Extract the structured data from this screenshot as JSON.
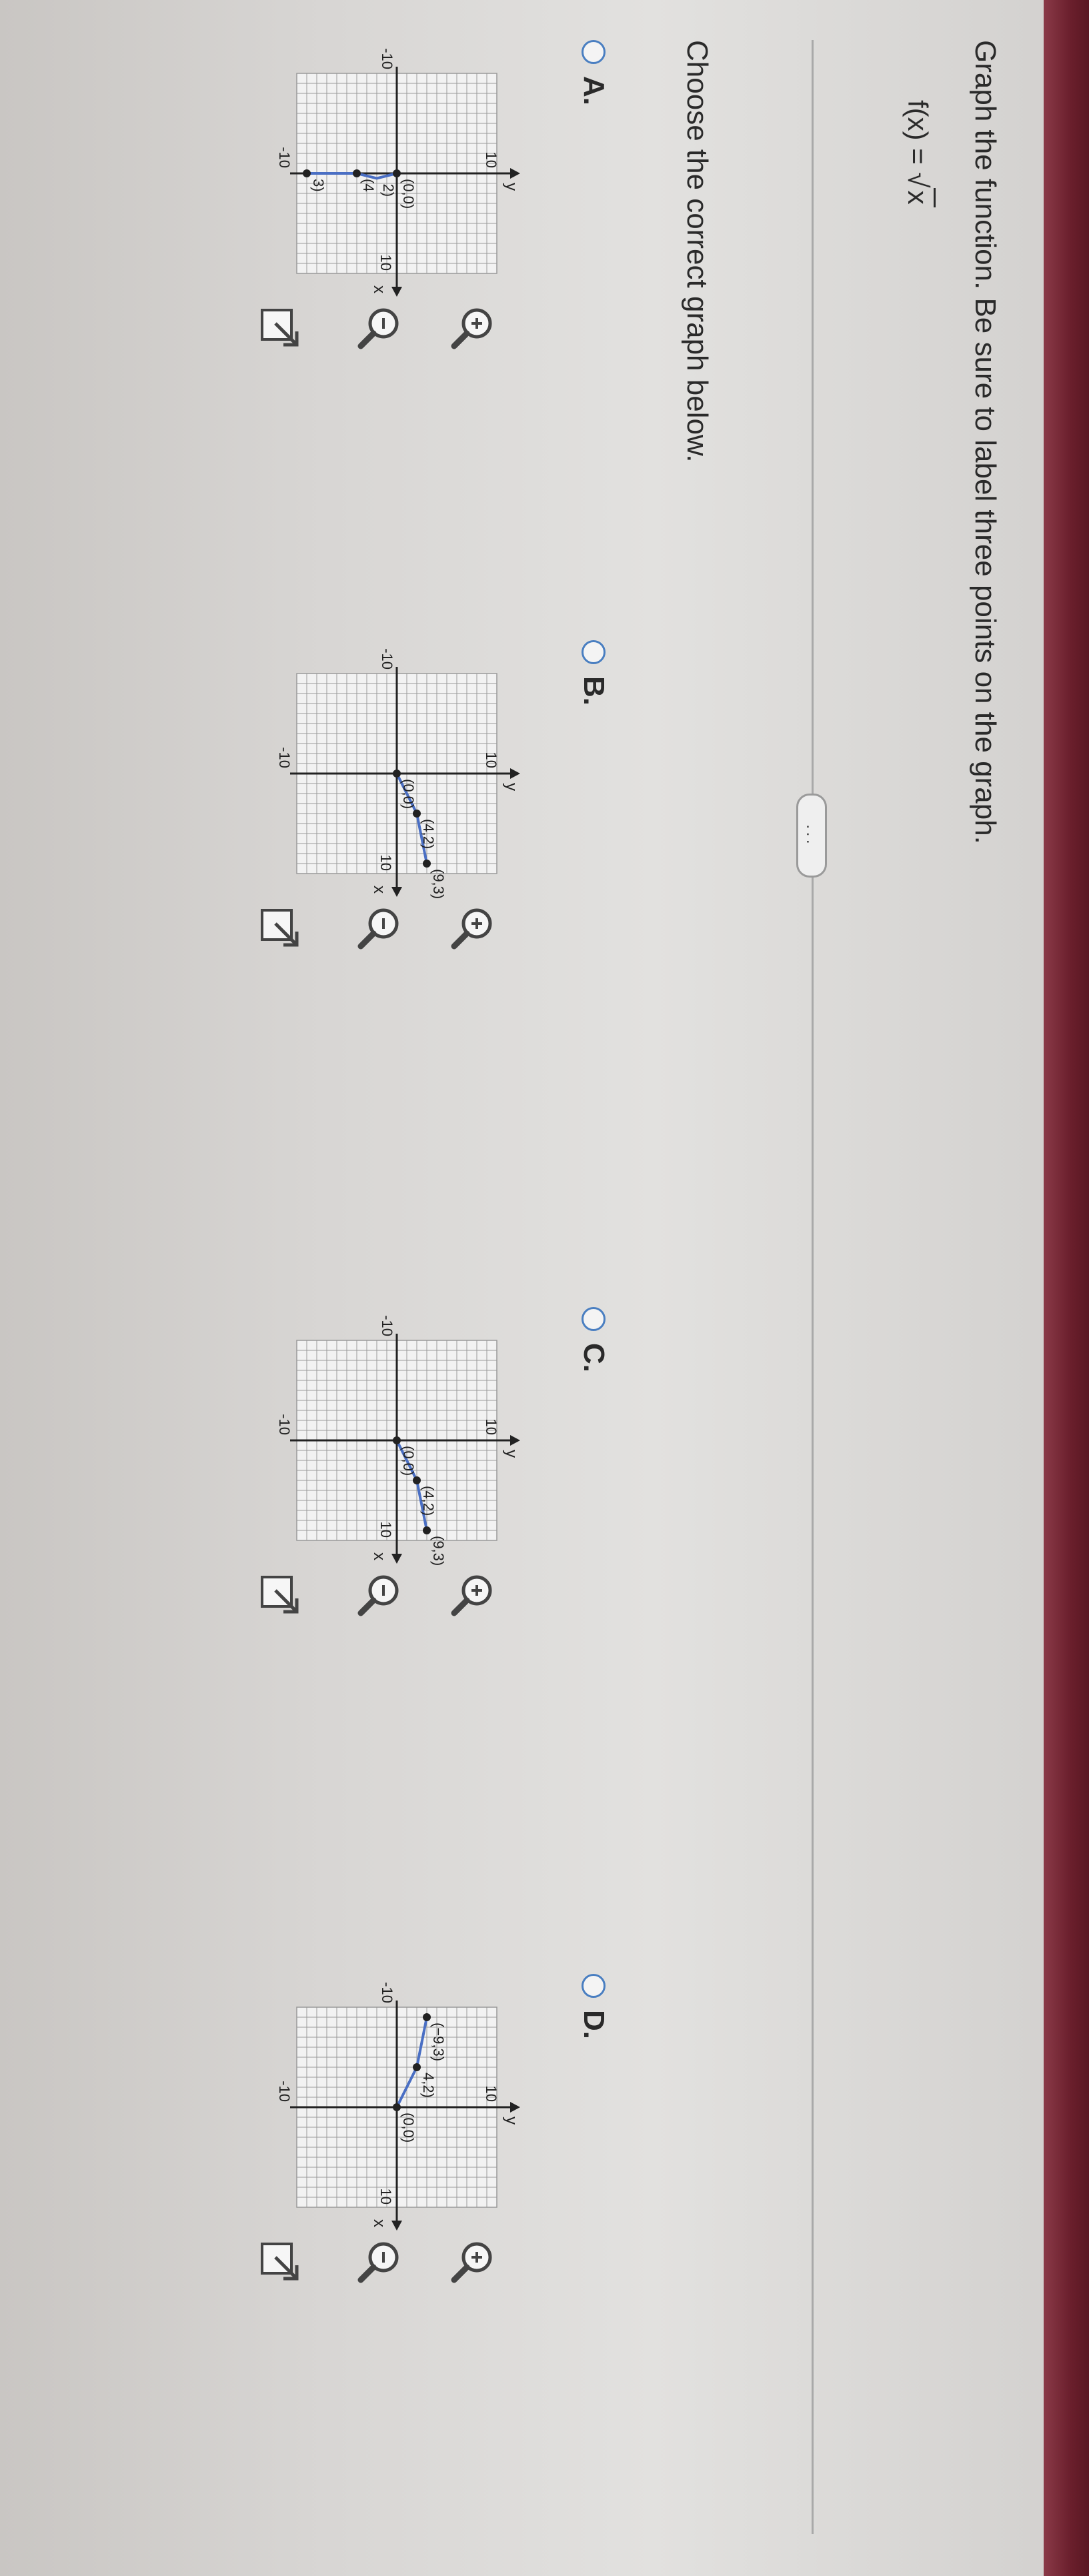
{
  "question": {
    "title": "Graph the function. Be sure to label three points on the graph.",
    "function_label": "f(x) = ",
    "function_radicand": "x",
    "prompt": "Choose the correct graph below.",
    "more_button": "..."
  },
  "axis": {
    "min_label": "-10",
    "max_label": "10",
    "x_label": "x",
    "y_label": "y"
  },
  "colors": {
    "curve": "#4a6fc4",
    "grid": "#9a9a9a",
    "radio": "#4a7fc1"
  },
  "icons": {
    "zoom_in": "zoom-in-icon",
    "zoom_out": "zoom-out-icon",
    "popout": "popout-icon"
  },
  "options": [
    {
      "letter": "A.",
      "points": [
        {
          "x": 0,
          "y": 0,
          "label": "(0,0)"
        },
        {
          "x": 0,
          "y": -4,
          "label": "(4"
        },
        {
          "x": 0,
          "y": -9,
          "label": "3)"
        }
      ],
      "mid_label": "2)",
      "curve": [
        [
          0,
          0
        ],
        [
          0.5,
          -2
        ],
        [
          0,
          -4
        ],
        [
          0,
          -9
        ]
      ]
    },
    {
      "letter": "B.",
      "points": [
        {
          "x": 0,
          "y": 0,
          "label": "(0,0)"
        },
        {
          "x": 4,
          "y": 2,
          "label": "(4,2)"
        },
        {
          "x": 9,
          "y": 3,
          "label": "(9,3)"
        }
      ],
      "curve": [
        [
          0,
          0
        ],
        [
          4,
          2
        ],
        [
          9,
          3
        ]
      ]
    },
    {
      "letter": "C.",
      "points": [
        {
          "x": 0,
          "y": 0,
          "label": "(0,0)"
        },
        {
          "x": 4,
          "y": 2,
          "label": "(4,2)"
        },
        {
          "x": 9,
          "y": 3,
          "label": "(9,3)"
        }
      ],
      "curve": [
        [
          0,
          0
        ],
        [
          4,
          2
        ],
        [
          9,
          3
        ]
      ]
    },
    {
      "letter": "D.",
      "points": [
        {
          "x": 0,
          "y": 0,
          "label": "(0,0)"
        },
        {
          "x": -4,
          "y": 2,
          "label": "4,2)"
        },
        {
          "x": -9,
          "y": 3,
          "label": "(−9,3)"
        }
      ],
      "curve": [
        [
          0,
          0
        ],
        [
          -4,
          2
        ],
        [
          -9,
          3
        ]
      ]
    }
  ]
}
